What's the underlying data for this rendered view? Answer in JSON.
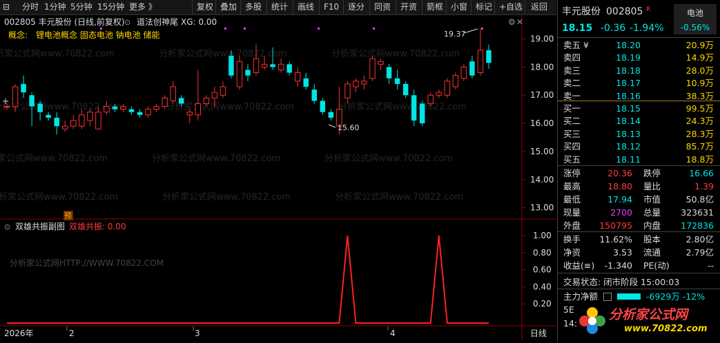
{
  "toolbar": {
    "left": [
      "分时",
      "1分钟",
      "5分钟",
      "15分钟",
      "更多 》"
    ],
    "right": [
      "复权",
      "叠加",
      "多股",
      "统计",
      "画线",
      "F10",
      "逐分",
      "同资",
      "开资",
      "箭框",
      "小窗",
      "标记",
      "+自选",
      "返回"
    ]
  },
  "main": {
    "title": "002805 丰元股份 (日线,前复权)",
    "indicator_name": "道法创神尾",
    "indicator_value": "XG: 0.00",
    "concept_label": "概念:",
    "concepts": "锂电池概念 固态电池 钠电池 储能",
    "watermark": "分析家公式网www.70822.com",
    "marker_high": "19.37",
    "marker_low": "15.60",
    "pre_badge": "预"
  },
  "sub": {
    "title": "双雄共振副图",
    "value": "双雄共振: 0.00",
    "watermark": "分析家公式网HTTP://WWW.70822.COM"
  },
  "xaxis": {
    "year": "2026年",
    "m2": "2",
    "m3": "3",
    "m4": "4",
    "period": "日线"
  },
  "colors": {
    "up": "#ff3030",
    "down": "#00e5e5",
    "bg": "#000000",
    "text": "#cccccc"
  },
  "chart_data": {
    "type": "candlestick",
    "ylim": [
      12.6,
      19.6
    ],
    "yticks": [
      "19.00",
      "18.00",
      "17.00",
      "16.00",
      "15.00",
      "14.00",
      "13.00"
    ],
    "candles": [
      {
        "o": 16.6,
        "c": 16.6,
        "h": 16.7,
        "l": 16.5
      },
      {
        "o": 16.6,
        "c": 17.3,
        "h": 17.4,
        "l": 16.4
      },
      {
        "o": 17.4,
        "c": 17.1,
        "h": 17.7,
        "l": 16.9
      },
      {
        "o": 17.0,
        "c": 16.6,
        "h": 17.1,
        "l": 15.9
      },
      {
        "o": 16.7,
        "c": 16.4,
        "h": 16.8,
        "l": 16.1
      },
      {
        "o": 16.3,
        "c": 16.2,
        "h": 16.4,
        "l": 16.1
      },
      {
        "o": 16.2,
        "c": 15.9,
        "h": 16.4,
        "l": 15.6
      },
      {
        "o": 15.8,
        "c": 15.9,
        "h": 16.1,
        "l": 15.7
      },
      {
        "o": 15.9,
        "c": 16.1,
        "h": 16.3,
        "l": 15.8
      },
      {
        "o": 15.9,
        "c": 16.3,
        "h": 16.5,
        "l": 15.8
      },
      {
        "o": 16.1,
        "c": 16.4,
        "h": 16.5,
        "l": 15.9
      },
      {
        "o": 15.8,
        "c": 16.4,
        "h": 16.6,
        "l": 15.8
      },
      {
        "o": 16.4,
        "c": 16.6,
        "h": 16.8,
        "l": 16.3
      },
      {
        "o": 16.6,
        "c": 16.5,
        "h": 16.7,
        "l": 16.4
      },
      {
        "o": 16.5,
        "c": 16.6,
        "h": 16.7,
        "l": 16.4
      },
      {
        "o": 16.5,
        "c": 16.4,
        "h": 16.6,
        "l": 16.3
      },
      {
        "o": 16.4,
        "c": 16.3,
        "h": 16.5,
        "l": 16.2
      },
      {
        "o": 16.3,
        "c": 16.5,
        "h": 16.6,
        "l": 16.2
      },
      {
        "o": 16.5,
        "c": 16.6,
        "h": 16.7,
        "l": 16.4
      },
      {
        "o": 16.6,
        "c": 16.9,
        "h": 17.0,
        "l": 16.5
      },
      {
        "o": 16.8,
        "c": 17.3,
        "h": 17.5,
        "l": 16.7
      },
      {
        "o": 16.9,
        "c": 16.7,
        "h": 17.0,
        "l": 16.6
      },
      {
        "o": 16.3,
        "c": 16.4,
        "h": 16.5,
        "l": 16.0
      },
      {
        "o": 16.3,
        "c": 16.7,
        "h": 17.9,
        "l": 16.1
      },
      {
        "o": 16.7,
        "c": 16.9,
        "h": 17.0,
        "l": 16.6
      },
      {
        "o": 16.9,
        "c": 17.1,
        "h": 17.3,
        "l": 16.6
      },
      {
        "o": 17.0,
        "c": 17.3,
        "h": 17.5,
        "l": 16.9
      },
      {
        "o": 18.4,
        "c": 17.7,
        "h": 18.6,
        "l": 17.6
      },
      {
        "o": 17.3,
        "c": 18.2,
        "h": 18.4,
        "l": 17.2
      },
      {
        "o": 17.9,
        "c": 17.7,
        "h": 18.1,
        "l": 17.5
      },
      {
        "o": 17.8,
        "c": 18.3,
        "h": 18.8,
        "l": 17.7
      },
      {
        "o": 18.0,
        "c": 18.1,
        "h": 18.4,
        "l": 17.9
      },
      {
        "o": 18.1,
        "c": 18.0,
        "h": 18.7,
        "l": 17.9
      },
      {
        "o": 17.9,
        "c": 18.1,
        "h": 18.3,
        "l": 17.8
      },
      {
        "o": 18.1,
        "c": 17.8,
        "h": 18.2,
        "l": 17.7
      },
      {
        "o": 17.5,
        "c": 17.8,
        "h": 18.0,
        "l": 17.3
      },
      {
        "o": 17.6,
        "c": 17.3,
        "h": 17.8,
        "l": 17.2
      },
      {
        "o": 17.2,
        "c": 16.8,
        "h": 17.4,
        "l": 16.7
      },
      {
        "o": 16.8,
        "c": 16.4,
        "h": 16.9,
        "l": 16.3
      },
      {
        "o": 16.4,
        "c": 16.2,
        "h": 16.5,
        "l": 16.1
      },
      {
        "o": 15.9,
        "c": 16.5,
        "h": 17.3,
        "l": 15.6
      },
      {
        "o": 16.9,
        "c": 17.4,
        "h": 17.5,
        "l": 16.7
      },
      {
        "o": 17.3,
        "c": 17.5,
        "h": 17.6,
        "l": 17.1
      },
      {
        "o": 17.4,
        "c": 17.5,
        "h": 17.7,
        "l": 17.2
      },
      {
        "o": 17.6,
        "c": 18.3,
        "h": 18.4,
        "l": 17.5
      },
      {
        "o": 18.1,
        "c": 18.2,
        "h": 18.3,
        "l": 17.9
      },
      {
        "o": 18.0,
        "c": 17.6,
        "h": 18.1,
        "l": 17.4
      },
      {
        "o": 17.6,
        "c": 17.4,
        "h": 17.9,
        "l": 17.2
      },
      {
        "o": 17.4,
        "c": 17.0,
        "h": 17.5,
        "l": 16.9
      },
      {
        "o": 17.0,
        "c": 16.1,
        "h": 17.2,
        "l": 15.9
      },
      {
        "o": 16.7,
        "c": 16.0,
        "h": 16.8,
        "l": 15.9
      },
      {
        "o": 16.7,
        "c": 17.0,
        "h": 17.1,
        "l": 16.6
      },
      {
        "o": 17.0,
        "c": 17.1,
        "h": 17.2,
        "l": 16.9
      },
      {
        "o": 17.0,
        "c": 17.5,
        "h": 17.6,
        "l": 16.9
      },
      {
        "o": 17.3,
        "c": 17.7,
        "h": 17.8,
        "l": 17.2
      },
      {
        "o": 17.6,
        "c": 18.0,
        "h": 18.1,
        "l": 17.5
      },
      {
        "o": 18.2,
        "c": 17.7,
        "h": 18.4,
        "l": 17.6
      },
      {
        "o": 17.8,
        "c": 18.6,
        "h": 19.37,
        "l": 17.7
      },
      {
        "o": 18.6,
        "c": 18.15,
        "h": 18.8,
        "l": 17.94
      }
    ],
    "sub_series": {
      "name": "双雄共振",
      "ylim": [
        0,
        1.0
      ],
      "yticks": [
        "1.00",
        "0.80",
        "0.60",
        "0.40",
        "0.20"
      ],
      "peak_index": [
        41,
        52
      ]
    }
  },
  "panel": {
    "name": "丰元股份",
    "code": "002805",
    "r_badge": "R",
    "sector": "电池",
    "sector_pct": "-0.56%",
    "price": "18.15",
    "change": "-0.36",
    "pct": "-1.94%",
    "asks": [
      {
        "label": "卖五 ¥",
        "price": "18.20",
        "vol": "20.9万"
      },
      {
        "label": "卖四",
        "price": "18.19",
        "vol": "14.9万"
      },
      {
        "label": "卖三",
        "price": "18.18",
        "vol": "28.0万"
      },
      {
        "label": "卖二",
        "price": "18.17",
        "vol": "10.9万"
      },
      {
        "label": "卖一",
        "price": "18.16",
        "vol": "38.3万"
      }
    ],
    "bids": [
      {
        "label": "买一",
        "price": "18.15",
        "vol": "99.5万"
      },
      {
        "label": "买二",
        "price": "18.14",
        "vol": "24.3万"
      },
      {
        "label": "买三",
        "price": "18.13",
        "vol": "28.3万"
      },
      {
        "label": "买四",
        "price": "18.12",
        "vol": "85.7万"
      },
      {
        "label": "买五",
        "price": "18.11",
        "vol": "18.8万"
      }
    ],
    "stats1": [
      {
        "k1": "涨停",
        "v1": "20.36",
        "k2": "跌停",
        "v2": "16.66"
      },
      {
        "k1": "最高",
        "v1": "18.80",
        "k2": "量比",
        "v2": "1.39"
      },
      {
        "k1": "最低",
        "v1": "17.94",
        "k2": "市值",
        "v2": "50.8亿"
      },
      {
        "k1": "现量",
        "v1": "2700",
        "k2": "总量",
        "v2": "323631"
      },
      {
        "k1": "外盘",
        "v1": "150795",
        "k2": "内盘",
        "v2": "172836"
      }
    ],
    "stats2": [
      {
        "k1": "换手",
        "v1": "11.62%",
        "k2": "股本",
        "v2": "2.80亿"
      },
      {
        "k1": "净资",
        "v1": "3.53",
        "k2": "流通",
        "v2": "2.79亿"
      },
      {
        "k1": "收益(≡)",
        "v1": "-1.340",
        "k2": "PE(动)",
        "v2": "--"
      }
    ],
    "trade_status": "交易状态: 闭市阶段 15:00:03",
    "main_flow_label": "主力净额",
    "main_flow_value": "-6929万 -12%",
    "cut1": "5E",
    "cut2": "14:",
    "logo_text": "分析家公式网",
    "logo_url": "www.70822.com"
  }
}
